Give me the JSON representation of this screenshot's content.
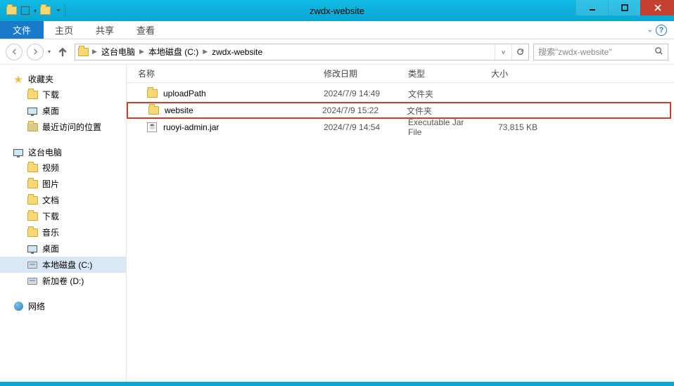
{
  "window": {
    "title": "zwdx-website"
  },
  "ribbon": {
    "file": "文件",
    "tabs": [
      "主页",
      "共享",
      "查看"
    ]
  },
  "breadcrumb": {
    "items": [
      "这台电脑",
      "本地磁盘 (C:)",
      "zwdx-website"
    ]
  },
  "search": {
    "placeholder": "搜索\"zwdx-website\""
  },
  "navpane": {
    "favorites": {
      "label": "收藏夹",
      "items": [
        "下载",
        "桌面",
        "最近访问的位置"
      ]
    },
    "computer": {
      "label": "这台电脑",
      "items": [
        "视频",
        "图片",
        "文档",
        "下载",
        "音乐",
        "桌面",
        "本地磁盘 (C:)",
        "新加卷 (D:)"
      ]
    },
    "network": {
      "label": "网络"
    }
  },
  "columns": {
    "name": "名称",
    "date": "修改日期",
    "type": "类型",
    "size": "大小"
  },
  "files": [
    {
      "name": "uploadPath",
      "date": "2024/7/9 14:49",
      "type": "文件夹",
      "size": "",
      "icon": "folder"
    },
    {
      "name": "website",
      "date": "2024/7/9 15:22",
      "type": "文件夹",
      "size": "",
      "icon": "folder",
      "highlight": true
    },
    {
      "name": "ruoyi-admin.jar",
      "date": "2024/7/9 14:54",
      "type": "Executable Jar File",
      "size": "73,815 KB",
      "icon": "jar"
    }
  ]
}
